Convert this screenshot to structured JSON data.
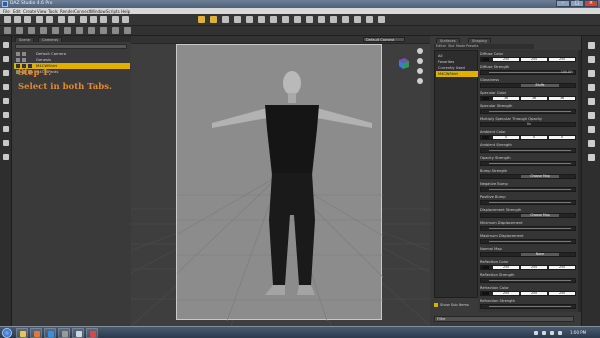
{
  "window": {
    "title": "DAZ Studio 4.6 Pro"
  },
  "menubar": [
    "File",
    "Edit",
    "Create",
    "View",
    "Tools",
    "Render",
    "Connect",
    "Window",
    "Scripts",
    "Help"
  ],
  "scene_pane": {
    "tabs": [
      "Scene",
      "Cameras"
    ],
    "rows": [
      {
        "label": "Default Camera",
        "selected": false
      },
      {
        "label": "Genesis",
        "selected": false
      },
      {
        "label": "M4CWShirt",
        "selected": true
      },
      {
        "label": "M4CWPants",
        "selected": false
      }
    ]
  },
  "annotation": {
    "line1": "Step 1.",
    "line2": "Select in both Tabs."
  },
  "viewport": {
    "camera": "Default Camera"
  },
  "surfaces": {
    "top_tabs": [
      "Surfaces",
      "Shaping"
    ],
    "sub_tabs": [
      "Editor",
      "Shd",
      "Mode",
      "Presets"
    ],
    "list": [
      {
        "label": "All",
        "selected": false
      },
      {
        "label": "Favorites",
        "selected": false
      },
      {
        "label": "Currently Used",
        "selected": false
      },
      {
        "label": "M4CWShirt",
        "selected": true
      }
    ],
    "show_sub_items": "Show Sub Items",
    "filter_placeholder": "Filter"
  },
  "properties": [
    {
      "label": "Diffuse Color",
      "kind": "rgb",
      "values": [
        "255",
        "255",
        "255"
      ]
    },
    {
      "label": "Diffuse Strength",
      "kind": "slider",
      "value": "100.0%"
    },
    {
      "label": "Glossiness",
      "kind": "map",
      "value": "Bluffs"
    },
    {
      "label": "Specular Color",
      "kind": "rgb",
      "values": [
        "36",
        "36",
        "36"
      ]
    },
    {
      "label": "Specular Strength",
      "kind": "slider",
      "value": ""
    },
    {
      "label": "Multiply Specular Through Opacity",
      "kind": "toggle",
      "value": "On"
    },
    {
      "label": "Ambient Color",
      "kind": "rgb",
      "values": [
        "0",
        "0",
        "0"
      ]
    },
    {
      "label": "Ambient Strength",
      "kind": "slider",
      "value": ""
    },
    {
      "label": "Opacity Strength",
      "kind": "slider",
      "value": ""
    },
    {
      "label": "Bump Strength",
      "kind": "map",
      "value": "Choose Map"
    },
    {
      "label": "Negative Bump",
      "kind": "slider",
      "value": ""
    },
    {
      "label": "Positive Bump",
      "kind": "slider",
      "value": ""
    },
    {
      "label": "Displacement Strength",
      "kind": "map",
      "value": "Choose Map"
    },
    {
      "label": "Minimum Displacement",
      "kind": "slider",
      "value": ""
    },
    {
      "label": "Maximum Displacement",
      "kind": "slider",
      "value": ""
    },
    {
      "label": "Normal Map",
      "kind": "map",
      "value": "None"
    },
    {
      "label": "Reflection Color",
      "kind": "rgb",
      "values": [
        "255",
        "255",
        "255"
      ]
    },
    {
      "label": "Reflection Strength",
      "kind": "slider",
      "value": ""
    },
    {
      "label": "Refraction Color",
      "kind": "rgb",
      "values": [
        "255",
        "255",
        "255"
      ]
    },
    {
      "label": "Refraction Strength",
      "kind": "slider",
      "value": ""
    }
  ],
  "taskbar": {
    "time": "1:00 PM"
  },
  "colors": {
    "selection": "#e0b000",
    "annotation": "#e68a2e",
    "panel": "#3a3a3a"
  }
}
